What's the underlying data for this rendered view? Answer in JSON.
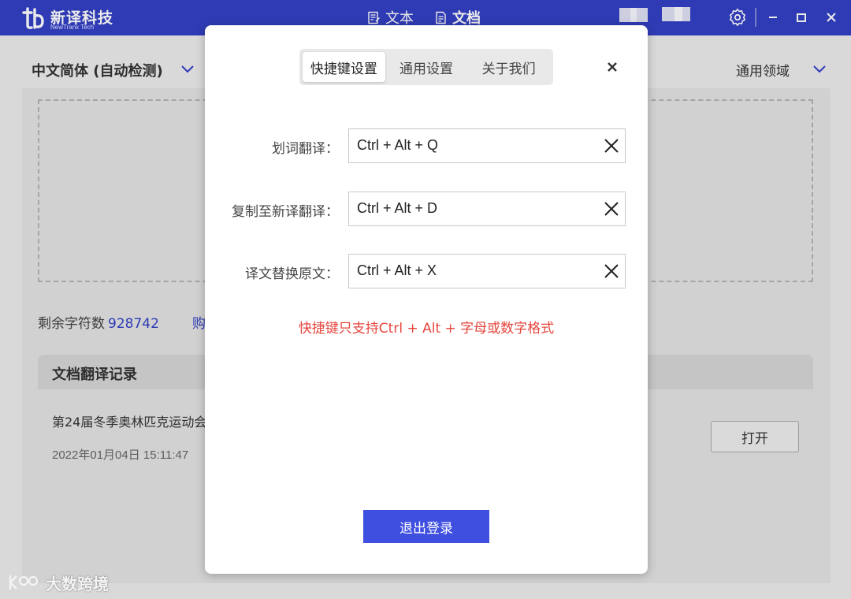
{
  "app": {
    "logo_name": "新译科技",
    "logo_sub": "NewTranx Tech",
    "nav": [
      {
        "label": "文本",
        "icon": "text-doc-icon",
        "active": false
      },
      {
        "label": "文档",
        "icon": "file-doc-icon",
        "active": true
      }
    ],
    "accent": "#3341c4"
  },
  "main": {
    "source_language": "中文简体 (自动检测)",
    "domain": "通用领域",
    "remaining_label": "剩余字符数",
    "remaining_count": "928742",
    "buy_link": "购",
    "history_title": "文档翻译记录",
    "history": [
      {
        "name": "第24届冬季奥林匹克运动会",
        "time": "2022年01月04日 15:11:47",
        "action": "打开"
      }
    ]
  },
  "dialog": {
    "tabs": [
      {
        "label": "快捷键设置",
        "active": true
      },
      {
        "label": "通用设置",
        "active": false
      },
      {
        "label": "关于我们",
        "active": false
      }
    ],
    "shortcuts": [
      {
        "label": "划词翻译：",
        "value": "Ctrl + Alt + Q"
      },
      {
        "label": "复制至新译翻译：",
        "value": "Ctrl + Alt + D"
      },
      {
        "label": "译文替换原文：",
        "value": "Ctrl + Alt + X"
      }
    ],
    "hint": "快捷键只支持Ctrl + Alt + 字母或数字格式",
    "hint_color": "#e5463d",
    "logout": "退出登录",
    "logout_color": "#3f4fe0"
  },
  "watermark": "大数跨境"
}
